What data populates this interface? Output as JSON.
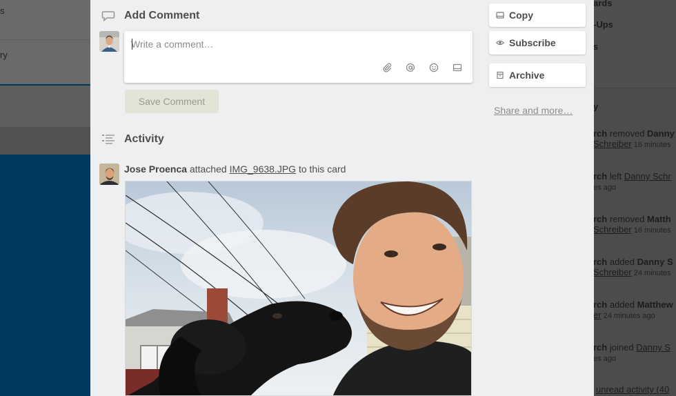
{
  "background_left": {
    "list_fragments": [
      "s",
      "ry"
    ]
  },
  "background_right": {
    "top_fragments": [
      "ards",
      "-Ups",
      "s"
    ],
    "activity_heading_fragment": "y",
    "entries": [
      {
        "l1_member": "rch",
        "l1_action": " removed ",
        "l1_target": "Danny",
        "l2_link": "Schreiber",
        "l2_time": " 16 minutes"
      },
      {
        "l1_member": "rch",
        "l1_action": " left ",
        "l1_target": "Danny Schr",
        "l2_link": "",
        "l2_time": "es ago"
      },
      {
        "l1_member": "rch",
        "l1_action": " removed ",
        "l1_target": "Matth",
        "l2_link": "Schreiber",
        "l2_time": " 16 minutes"
      },
      {
        "l1_member": "rch",
        "l1_action": " added ",
        "l1_target": "Danny S",
        "l2_link": "Schreiber",
        "l2_time": " 24 minutes"
      },
      {
        "l1_member": "rch",
        "l1_action": " added ",
        "l1_target": "Matthew",
        "l2_link": "er",
        "l2_time": " 24 minutes ago"
      },
      {
        "l1_member": "rch",
        "l1_action": " joined ",
        "l1_target": "Danny S",
        "l2_link": "",
        "l2_time": "es ago"
      }
    ],
    "unread_link": "unread activity (40"
  },
  "comment": {
    "title": "Add Comment",
    "placeholder": "Write a comment…",
    "tools": [
      "paperclip-icon",
      "mention-icon",
      "emoji-icon",
      "card-icon"
    ],
    "save_label": "Save Comment"
  },
  "activity": {
    "title": "Activity",
    "entry": {
      "member": "Jose Proenca",
      "verb": " attached ",
      "attachment": "IMG_9638.JPG",
      "suffix": " to this card"
    }
  },
  "actions": {
    "copy_label": "Copy",
    "subscribe_label": "Subscribe",
    "archive_label": "Archive",
    "share_label": "Share and more…"
  }
}
